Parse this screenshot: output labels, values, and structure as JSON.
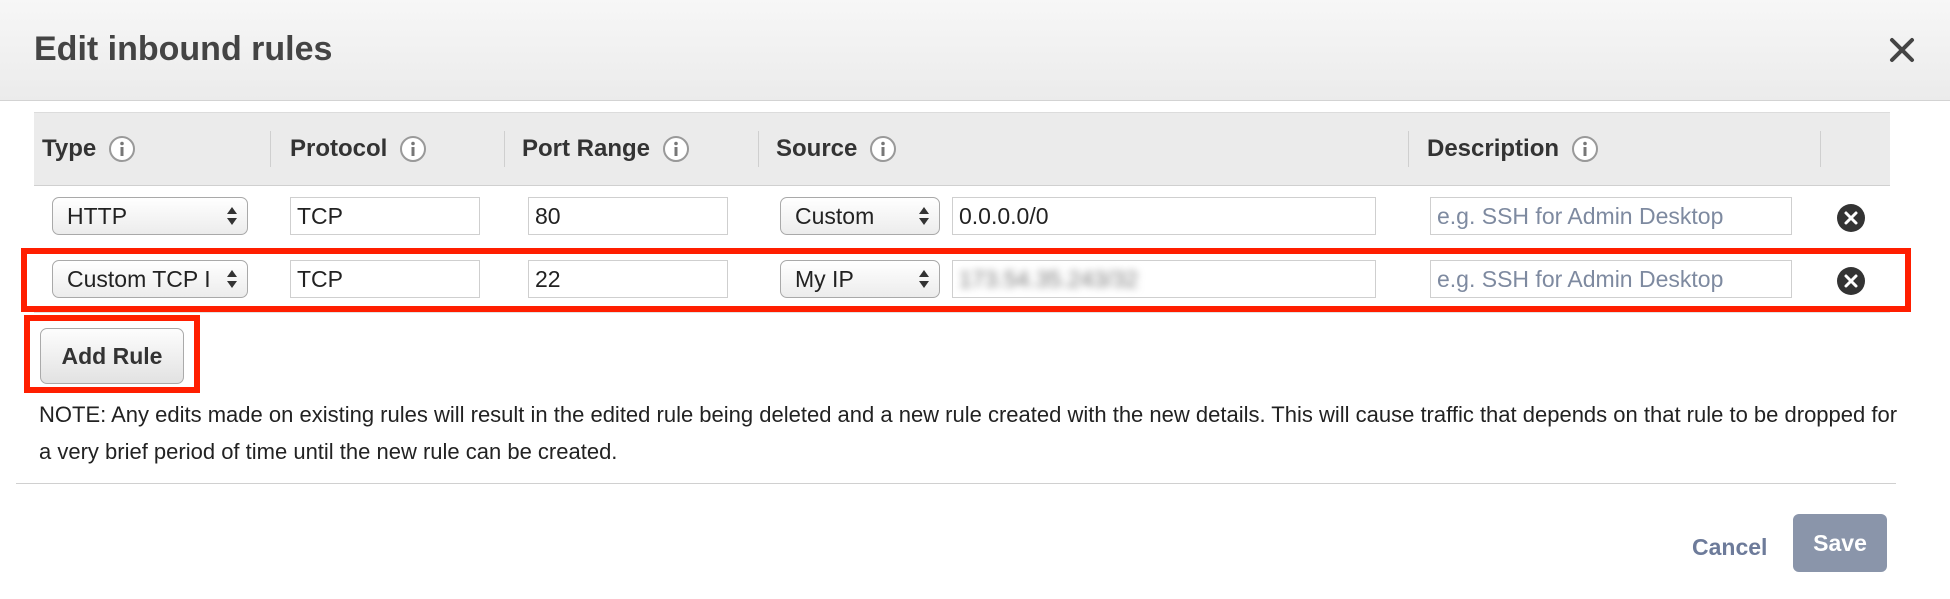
{
  "dialog": {
    "title": "Edit inbound rules"
  },
  "columns": {
    "type": "Type",
    "protocol": "Protocol",
    "port_range": "Port Range",
    "source": "Source",
    "description": "Description"
  },
  "rows": [
    {
      "type": "HTTP",
      "protocol": "TCP",
      "port": "80",
      "source_mode": "Custom",
      "source_value": "0.0.0.0/0",
      "description_placeholder": "e.g. SSH for Admin Desktop"
    },
    {
      "type": "Custom TCP I",
      "protocol": "TCP",
      "port": "22",
      "source_mode": "My IP",
      "source_value": "173.54.35.243/32",
      "description_placeholder": "e.g. SSH for Admin Desktop"
    }
  ],
  "buttons": {
    "add_rule": "Add Rule",
    "cancel": "Cancel",
    "save": "Save"
  },
  "note": "NOTE: Any edits made on existing rules will result in the edited rule being deleted and a new rule created with the new details. This will cause traffic that depends on that rule to be dropped for a very brief period of time until the new rule can be created.",
  "colors": {
    "highlight": "#ff1e00",
    "save_bg": "#8a95aa",
    "cancel_text": "#6d7b9a",
    "placeholder": "#7e8aa0"
  },
  "icons": {
    "close": "close-x-icon",
    "info": "info-icon",
    "remove": "remove-circle-icon",
    "select_arrows": "updown-arrows-icon"
  }
}
